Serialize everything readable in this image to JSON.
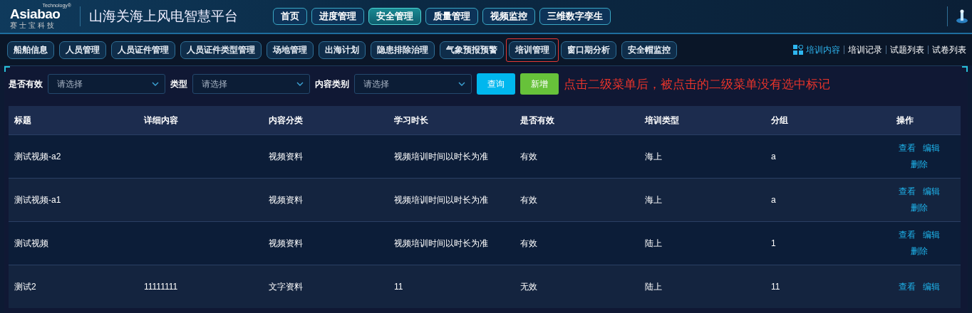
{
  "header": {
    "logo": {
      "tagline": "Technology®",
      "name": "Asiabao",
      "subname": "赛士宝科技"
    },
    "title": "山海关海上风电智慧平台"
  },
  "main_nav": [
    {
      "label": "首页",
      "selected": false
    },
    {
      "label": "进度管理",
      "selected": false
    },
    {
      "label": "安全管理",
      "selected": true
    },
    {
      "label": "质量管理",
      "selected": false
    },
    {
      "label": "视频监控",
      "selected": false
    },
    {
      "label": "三维数字孪生",
      "selected": false
    }
  ],
  "sub_nav": [
    {
      "label": "船舶信息",
      "selected": false,
      "highlighted": false
    },
    {
      "label": "人员管理",
      "selected": false,
      "highlighted": false
    },
    {
      "label": "人员证件管理",
      "selected": false,
      "highlighted": false
    },
    {
      "label": "人员证件类型管理",
      "selected": false,
      "highlighted": false
    },
    {
      "label": "场地管理",
      "selected": false,
      "highlighted": false
    },
    {
      "label": "出海计划",
      "selected": false,
      "highlighted": false
    },
    {
      "label": "隐患排除治理",
      "selected": false,
      "highlighted": false
    },
    {
      "label": "气象预报预警",
      "selected": false,
      "highlighted": false
    },
    {
      "label": "培训管理",
      "selected": false,
      "highlighted": true
    },
    {
      "label": "窗口期分析",
      "selected": false,
      "highlighted": false
    },
    {
      "label": "安全帽监控",
      "selected": false,
      "highlighted": false
    }
  ],
  "page_tabs": [
    {
      "label": "培训内容",
      "selected": true
    },
    {
      "label": "培训记录",
      "selected": false
    },
    {
      "label": "试题列表",
      "selected": false
    },
    {
      "label": "试卷列表",
      "selected": false
    }
  ],
  "filters": [
    {
      "label": "是否有效",
      "placeholder": "请选择"
    },
    {
      "label": "类型",
      "placeholder": "请选择"
    },
    {
      "label": "内容类别",
      "placeholder": "请选择"
    }
  ],
  "buttons": [
    {
      "label": "查询",
      "kind": "primary"
    },
    {
      "label": "新增",
      "kind": "success"
    }
  ],
  "annotation": "点击二级菜单后，被点击的二级菜单没有选中标记",
  "table": {
    "columns": [
      "标题",
      "详细内容",
      "内容分类",
      "学习时长",
      "是否有效",
      "培训类型",
      "分组",
      "操作"
    ],
    "rows": [
      {
        "cells": [
          "测试视频-a2",
          "",
          "视频资料",
          "视频培训时间以时长为准",
          "有效",
          "海上",
          "a"
        ],
        "actions": [
          "查看",
          "编辑",
          "删除"
        ]
      },
      {
        "cells": [
          "测试视频-a1",
          "",
          "视频资料",
          "视频培训时间以时长为准",
          "有效",
          "海上",
          "a"
        ],
        "actions": [
          "查看",
          "编辑",
          "删除"
        ]
      },
      {
        "cells": [
          "测试视频",
          "",
          "视频资料",
          "视频培训时间以时长为准",
          "有效",
          "陆上",
          "1"
        ],
        "actions": [
          "查看",
          "编辑",
          "删除"
        ]
      },
      {
        "cells": [
          "测试2",
          "11111111",
          "文字资料",
          "11",
          "无效",
          "陆上",
          "11"
        ],
        "actions": [
          "查看",
          "编辑"
        ]
      }
    ]
  }
}
